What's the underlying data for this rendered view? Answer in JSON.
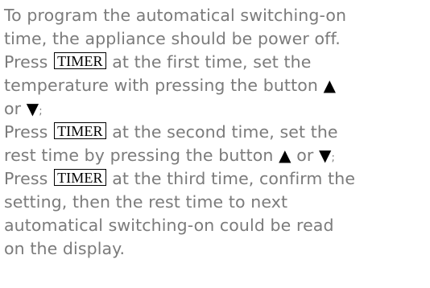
{
  "document": {
    "line1": "To program the automatical switching-on",
    "line2": "time, the appliance should be power off.",
    "line3_pre": "Press ",
    "line3_post": " at the first time, set the",
    "line4_pre": "temperature with pressing the button ",
    "line5_pre": "or ",
    "line5_post": ";",
    "line6_pre": "Press ",
    "line6_post": " at the second time, set the",
    "line7_pre": "rest time by pressing the button ",
    "line7_mid": " or ",
    "line7_post": ";",
    "line8_pre": "Press ",
    "line8_post": " at the third time, confirm the",
    "line9": "setting, then the rest time to next",
    "line10": "automatical switching-on could be read",
    "line11": "on the display.",
    "timer_key": "TIMER",
    "up_arrow": "▲",
    "down_arrow": "▼"
  }
}
